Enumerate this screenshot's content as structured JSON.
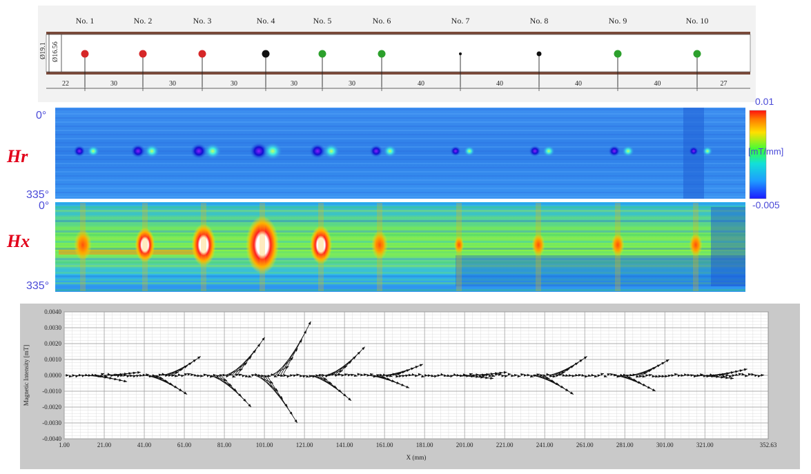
{
  "top": {
    "specimens": [
      "No. 1",
      "No. 2",
      "No. 3",
      "No. 4",
      "No. 5",
      "No. 6",
      "No. 7",
      "No. 8",
      "No. 9",
      "No. 10"
    ],
    "colors": [
      "#d62728",
      "#d62728",
      "#d62728",
      "#111111",
      "#2ca02c",
      "#2ca02c",
      "#111111",
      "#111111",
      "#2ca02c",
      "#2ca02c"
    ],
    "outer_dim": "Ø19.1",
    "inner_dim": "Ø16.56",
    "spacings": [
      "22",
      "30",
      "30",
      "30",
      "30",
      "30",
      "40",
      "40",
      "40",
      "40",
      "27"
    ]
  },
  "maps": {
    "hr_label": "Hr",
    "hx_label": "Hx",
    "angle_top": "0°",
    "angle_bottom": "335°",
    "colorbar_max": "0.01",
    "colorbar_unit": "[mT/mm]",
    "colorbar_min": "-0.005"
  },
  "chart_data": {
    "type": "line",
    "xlabel": "X (mm)",
    "ylabel": "Magnetic Intensity [mT]",
    "xlim": [
      1.0,
      352.63
    ],
    "ylim": [
      -0.004,
      0.004
    ],
    "x_ticks": [
      "1.00",
      "21.00",
      "41.00",
      "61.00",
      "81.00",
      "101.00",
      "121.00",
      "141.00",
      "161.00",
      "181.00",
      "201.00",
      "221.00",
      "241.00",
      "261.00",
      "281.00",
      "301.00",
      "321.00",
      "352.63"
    ],
    "y_ticks": [
      "0.0040",
      "0.0030",
      "0.0020",
      "0.0010",
      "0.0000",
      "-0.0010",
      "-0.0020",
      "-0.0030",
      "-0.0040"
    ],
    "grid": true,
    "peaks": [
      {
        "x": 24,
        "up": 0.0002,
        "down": -0.0004
      },
      {
        "x": 54,
        "up": 0.0012,
        "down": -0.0012
      },
      {
        "x": 86,
        "up": 0.0024,
        "down": -0.002
      },
      {
        "x": 109,
        "up": 0.0034,
        "down": -0.003
      },
      {
        "x": 136,
        "up": 0.0018,
        "down": -0.0016
      },
      {
        "x": 165,
        "up": 0.0007,
        "down": -0.0008
      },
      {
        "x": 207,
        "up": 0.0002,
        "down": -0.0002
      },
      {
        "x": 247,
        "up": 0.0012,
        "down": -0.0012
      },
      {
        "x": 288,
        "up": 0.001,
        "down": -0.001
      },
      {
        "x": 327,
        "up": 0.0004,
        "down": -0.0002
      }
    ]
  }
}
